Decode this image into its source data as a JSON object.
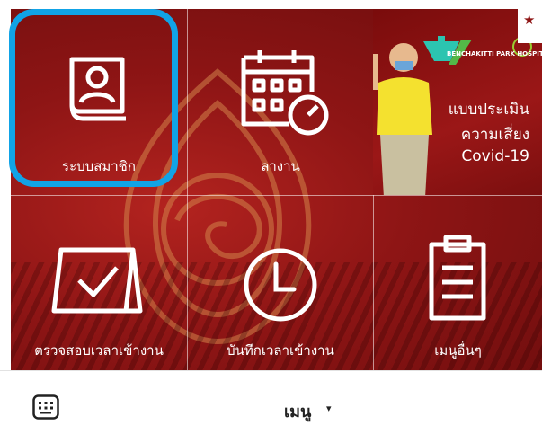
{
  "tiles": [
    {
      "label": "ระบบสมาชิก",
      "icon": "member-profile-icon"
    },
    {
      "label": "ลางาน",
      "icon": "calendar-clock-icon"
    },
    {
      "label": "ตรวจสอบเวลาเข้างาน",
      "icon": "calendar-check-icon"
    },
    {
      "label": "บันทึกเวลาเข้างาน",
      "icon": "clock-icon"
    },
    {
      "label": "เมนูอื่นๆ",
      "icon": "clipboard-icon"
    }
  ],
  "promo": {
    "hospital_name": "BENCHAKITTI PARK HOSPITAL",
    "line1": "แบบประเมิน",
    "line2": "ความเสี่ยง",
    "line3": "Covid-19"
  },
  "bottom_bar": {
    "menu_label": "เมนู",
    "caret": "▾",
    "keyboard_icon": "keyboard-icon"
  },
  "colors": {
    "background_red": "#8e1515",
    "highlight_blue": "#11a3e6",
    "text_white": "#ffffff"
  }
}
